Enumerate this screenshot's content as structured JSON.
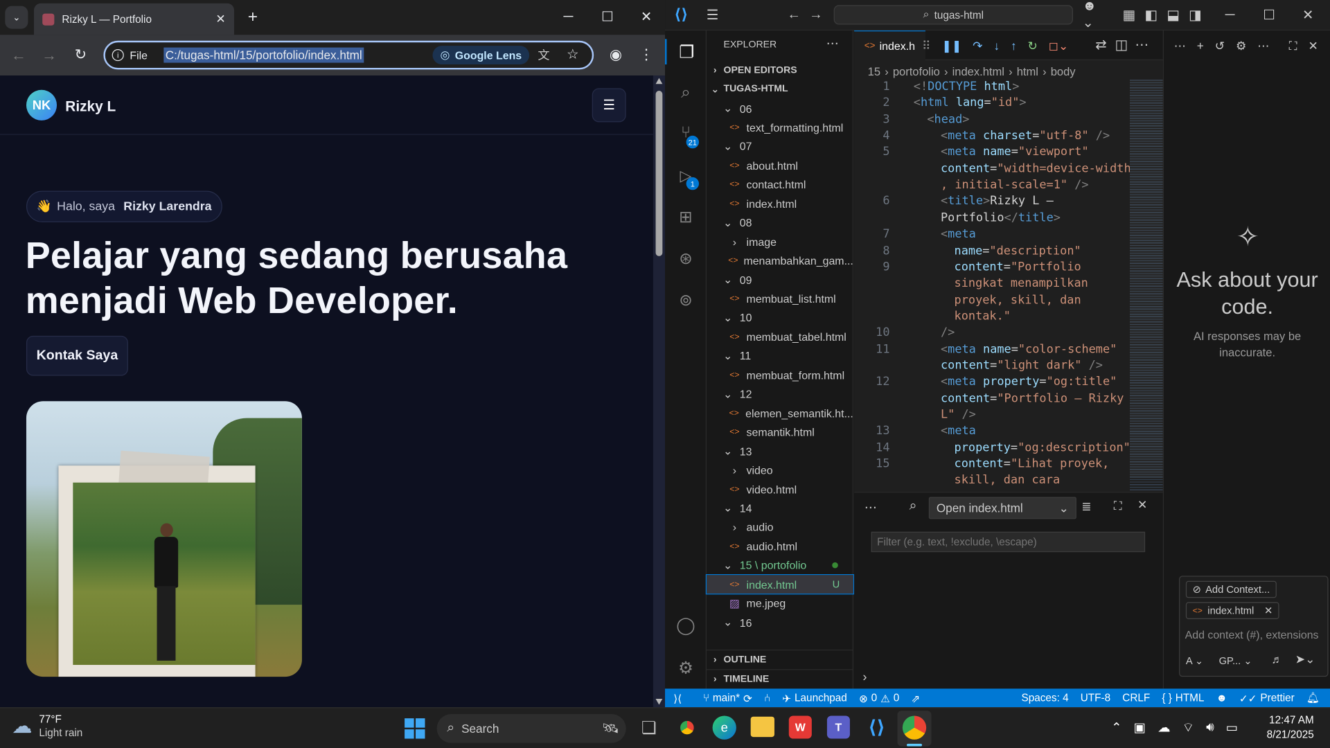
{
  "chrome": {
    "tab_title": "Rizky L — Portfolio",
    "new_tab": "+",
    "scheme_label": "File",
    "url": "C:/tugas-html/15/portofolio/index.html",
    "lens_label": "Google Lens"
  },
  "site": {
    "logo_initials": "NK",
    "brand": "Rizky L",
    "greeting_prefix": "Halo, saya",
    "greeting_name": "Rizky Larendra",
    "wave": "👋",
    "headline_line1": "Pelajar yang sedang berusaha",
    "headline_line2": "menjadi Web Developer.",
    "cta_label": "Kontak Saya"
  },
  "vscode": {
    "search_placeholder": "tugas-html",
    "explorer_title": "EXPLORER",
    "open_editors": "OPEN EDITORS",
    "root_folder": "TUGAS-HTML",
    "outline": "OUTLINE",
    "timeline": "TIMELINE",
    "tree": [
      {
        "type": "folder",
        "label": "06",
        "depth": 1,
        "open": true
      },
      {
        "type": "file",
        "label": "text_formatting.html",
        "depth": 2
      },
      {
        "type": "folder",
        "label": "07",
        "depth": 1,
        "open": true
      },
      {
        "type": "file",
        "label": "about.html",
        "depth": 2
      },
      {
        "type": "file",
        "label": "contact.html",
        "depth": 2
      },
      {
        "type": "file",
        "label": "index.html",
        "depth": 2
      },
      {
        "type": "folder",
        "label": "08",
        "depth": 1,
        "open": true
      },
      {
        "type": "folder",
        "label": "image",
        "depth": 2,
        "open": false
      },
      {
        "type": "file",
        "label": "menambahkan_gam...",
        "depth": 2
      },
      {
        "type": "folder",
        "label": "09",
        "depth": 1,
        "open": true
      },
      {
        "type": "file",
        "label": "membuat_list.html",
        "depth": 2
      },
      {
        "type": "folder",
        "label": "10",
        "depth": 1,
        "open": true
      },
      {
        "type": "file",
        "label": "membuat_tabel.html",
        "depth": 2
      },
      {
        "type": "folder",
        "label": "11",
        "depth": 1,
        "open": true
      },
      {
        "type": "file",
        "label": "membuat_form.html",
        "depth": 2
      },
      {
        "type": "folder",
        "label": "12",
        "depth": 1,
        "open": true
      },
      {
        "type": "file",
        "label": "elemen_semantik.ht...",
        "depth": 2
      },
      {
        "type": "file",
        "label": "semantik.html",
        "depth": 2
      },
      {
        "type": "folder",
        "label": "13",
        "depth": 1,
        "open": true
      },
      {
        "type": "folder",
        "label": "video",
        "depth": 2,
        "open": false
      },
      {
        "type": "file",
        "label": "video.html",
        "depth": 2
      },
      {
        "type": "folder",
        "label": "14",
        "depth": 1,
        "open": true
      },
      {
        "type": "folder",
        "label": "audio",
        "depth": 2,
        "open": false
      },
      {
        "type": "file",
        "label": "audio.html",
        "depth": 2
      },
      {
        "type": "folder",
        "label": "15 \\ portofolio",
        "depth": 1,
        "open": true,
        "modified": true
      },
      {
        "type": "file",
        "label": "index.html",
        "depth": 2,
        "selected": true,
        "badge": "U"
      },
      {
        "type": "image",
        "label": "me.jpeg",
        "depth": 2
      },
      {
        "type": "folder",
        "label": "16",
        "depth": 1,
        "open": true
      }
    ],
    "editor_tab": "index.h",
    "breadcrumb": [
      "15",
      "portofolio",
      "index.html",
      "html",
      "body"
    ],
    "code_lines": [
      {
        "n": "1",
        "parts": [
          [
            "t-gray",
            "<!"
          ],
          [
            "t-tag",
            "DOCTYPE "
          ],
          [
            "t-attr",
            "html"
          ],
          [
            "t-gray",
            ">"
          ]
        ],
        "indent": 0
      },
      {
        "n": "2",
        "parts": [
          [
            "t-gray",
            "<"
          ],
          [
            "t-tag",
            "html "
          ],
          [
            "t-attr",
            "lang"
          ],
          [
            "t-white",
            "="
          ],
          [
            "t-orange",
            "\"id\""
          ],
          [
            "t-gray",
            ">"
          ]
        ],
        "indent": 0
      },
      {
        "n": "3",
        "parts": [
          [
            "t-gray",
            "<"
          ],
          [
            "t-tag",
            "head"
          ],
          [
            "t-gray",
            ">"
          ]
        ],
        "indent": 1
      },
      {
        "n": "4",
        "parts": [
          [
            "t-gray",
            "<"
          ],
          [
            "t-tag",
            "meta "
          ],
          [
            "t-attr",
            "charset"
          ],
          [
            "t-white",
            "="
          ],
          [
            "t-orange",
            "\"utf-8\""
          ],
          [
            "t-gray",
            " />"
          ]
        ],
        "indent": 2
      },
      {
        "n": "5",
        "parts": [
          [
            "t-gray",
            "<"
          ],
          [
            "t-tag",
            "meta "
          ],
          [
            "t-attr",
            "name"
          ],
          [
            "t-white",
            "="
          ],
          [
            "t-orange",
            "\"viewport\""
          ]
        ],
        "indent": 2
      },
      {
        "n": "",
        "parts": [
          [
            "t-attr",
            "content"
          ],
          [
            "t-white",
            "="
          ],
          [
            "t-orange",
            "\"width=device-width"
          ]
        ],
        "indent": 2
      },
      {
        "n": "",
        "parts": [
          [
            "t-orange",
            ", initial-scale=1\""
          ],
          [
            "t-gray",
            " />"
          ]
        ],
        "indent": 2
      },
      {
        "n": "6",
        "parts": [
          [
            "t-gray",
            "<"
          ],
          [
            "t-tag",
            "title"
          ],
          [
            "t-gray",
            ">"
          ],
          [
            "t-white",
            "Rizky L —"
          ]
        ],
        "indent": 2
      },
      {
        "n": "",
        "parts": [
          [
            "t-white",
            "Portfolio"
          ],
          [
            "t-gray",
            "</"
          ],
          [
            "t-tag",
            "title"
          ],
          [
            "t-gray",
            ">"
          ]
        ],
        "indent": 2
      },
      {
        "n": "7",
        "parts": [
          [
            "t-gray",
            "<"
          ],
          [
            "t-tag",
            "meta"
          ]
        ],
        "indent": 2
      },
      {
        "n": "8",
        "parts": [
          [
            "t-attr",
            "name"
          ],
          [
            "t-white",
            "="
          ],
          [
            "t-orange",
            "\"description\""
          ]
        ],
        "indent": 3
      },
      {
        "n": "9",
        "parts": [
          [
            "t-attr",
            "content"
          ],
          [
            "t-white",
            "="
          ],
          [
            "t-orange",
            "\"Portfolio"
          ]
        ],
        "indent": 3
      },
      {
        "n": "",
        "parts": [
          [
            "t-orange",
            "singkat menampilkan"
          ]
        ],
        "indent": 3
      },
      {
        "n": "",
        "parts": [
          [
            "t-orange",
            "proyek, skill, dan"
          ]
        ],
        "indent": 3
      },
      {
        "n": "",
        "parts": [
          [
            "t-orange",
            "kontak.\""
          ]
        ],
        "indent": 3
      },
      {
        "n": "10",
        "parts": [
          [
            "t-gray",
            "/>"
          ]
        ],
        "indent": 2
      },
      {
        "n": "11",
        "parts": [
          [
            "t-gray",
            "<"
          ],
          [
            "t-tag",
            "meta "
          ],
          [
            "t-attr",
            "name"
          ],
          [
            "t-white",
            "="
          ],
          [
            "t-orange",
            "\"color-scheme\""
          ]
        ],
        "indent": 2
      },
      {
        "n": "",
        "parts": [
          [
            "t-attr",
            "content"
          ],
          [
            "t-white",
            "="
          ],
          [
            "t-orange",
            "\"light dark\""
          ],
          [
            "t-gray",
            " />"
          ]
        ],
        "indent": 2
      },
      {
        "n": "12",
        "parts": [
          [
            "t-gray",
            "<"
          ],
          [
            "t-tag",
            "meta "
          ],
          [
            "t-attr",
            "property"
          ],
          [
            "t-white",
            "="
          ],
          [
            "t-orange",
            "\"og:title\""
          ]
        ],
        "indent": 2
      },
      {
        "n": "",
        "parts": [
          [
            "t-attr",
            "content"
          ],
          [
            "t-white",
            "="
          ],
          [
            "t-orange",
            "\"Portfolio — Rizky"
          ]
        ],
        "indent": 2
      },
      {
        "n": "",
        "parts": [
          [
            "t-orange",
            "L\""
          ],
          [
            "t-gray",
            " />"
          ]
        ],
        "indent": 2
      },
      {
        "n": "13",
        "parts": [
          [
            "t-gray",
            "<"
          ],
          [
            "t-tag",
            "meta"
          ]
        ],
        "indent": 2
      },
      {
        "n": "14",
        "parts": [
          [
            "t-attr",
            "property"
          ],
          [
            "t-white",
            "="
          ],
          [
            "t-orange",
            "\"og:description\""
          ]
        ],
        "indent": 3
      },
      {
        "n": "15",
        "parts": [
          [
            "t-attr",
            "content"
          ],
          [
            "t-white",
            "="
          ],
          [
            "t-orange",
            "\"Lihat proyek,"
          ]
        ],
        "indent": 3
      },
      {
        "n": "",
        "parts": [
          [
            "t-orange",
            "skill, dan cara"
          ]
        ],
        "indent": 3
      }
    ],
    "panel_dropdown": "Open index.html",
    "panel_filter_placeholder": "Filter (e.g. text, !exclude, \\escape)",
    "chat_title": "Ask about your code.",
    "chat_sub": "AI responses may be inaccurate.",
    "add_context": "Add Context...",
    "context_file": "index.html",
    "chat_input_placeholder": "Add context (#), extensions",
    "chat_mode": "A",
    "chat_model": "GP...",
    "scm_badge": "21",
    "debug_badge": "1",
    "status": {
      "branch": "main*",
      "launchpad": "Launchpad",
      "errors": "0",
      "warnings": "0",
      "spaces": "Spaces: 4",
      "encoding": "UTF-8",
      "eol": "CRLF",
      "language": "HTML",
      "formatter": "Prettier"
    }
  },
  "taskbar": {
    "temp": "77°F",
    "weather": "Light rain",
    "search": "Search",
    "time": "12:47 AM",
    "date": "8/21/2025"
  }
}
